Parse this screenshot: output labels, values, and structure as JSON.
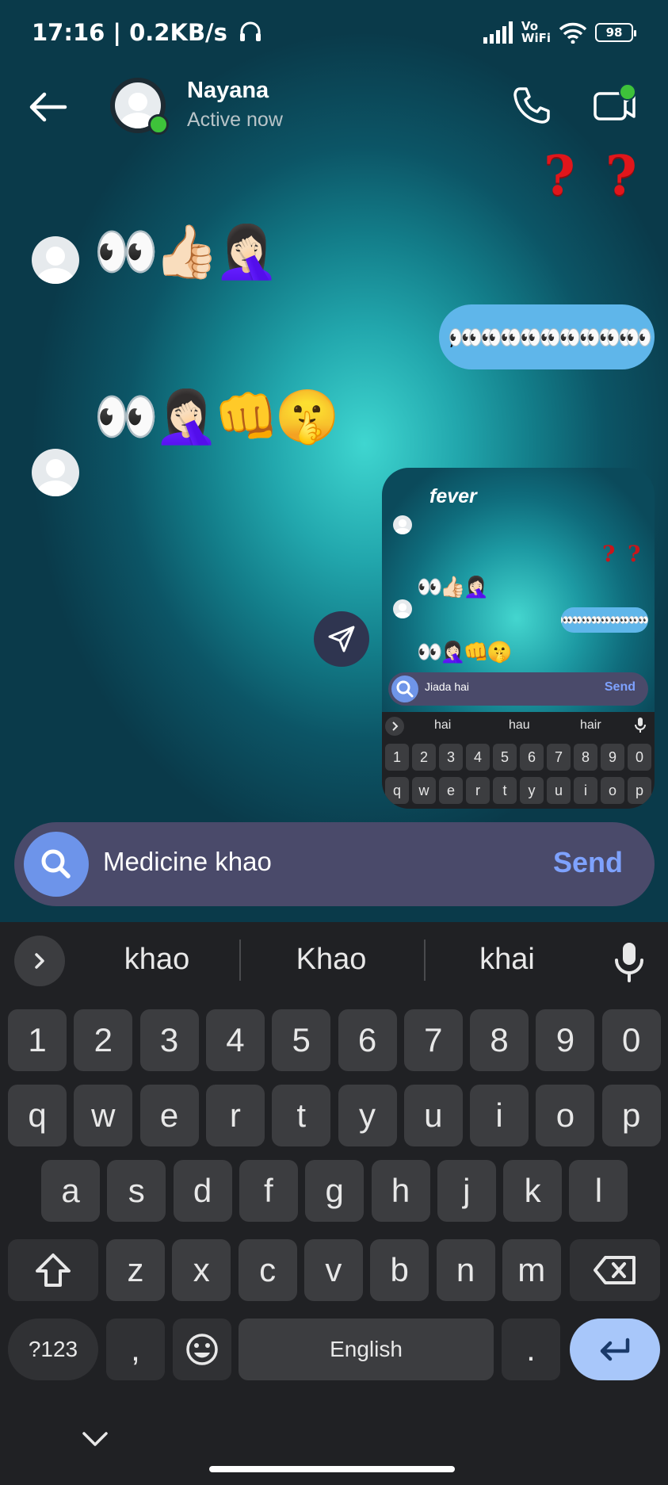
{
  "status_bar": {
    "time": "17:16 | 0.2KB/s",
    "vowifi_top": "Vo",
    "vowifi_bottom": "WiFi",
    "battery": "98"
  },
  "header": {
    "contact_name": "Nayana",
    "contact_status": "Active now"
  },
  "messages": {
    "question_marks": [
      "?",
      "?"
    ],
    "incoming_1": "👀👍🏻🤦🏻‍♀️",
    "outgoing_1": ",👀👀👀👀👀👀👀👀👀👀",
    "incoming_2": "👀🤦🏻‍♀️👊🤫"
  },
  "shared_screenshot": {
    "brand": "fever",
    "question_marks": [
      "?",
      "?"
    ],
    "incoming_1": "👀👍🏻🤦🏻‍♀️",
    "outgoing_1": "👀👀👀👀👀👀👀👀👀👀",
    "incoming_2": "👀🤦🏻‍♀️👊🤫",
    "input_text": "Jiada hai",
    "send_label": "Send",
    "suggestions": [
      "hai",
      "hau",
      "hair"
    ],
    "number_keys": [
      "1",
      "2",
      "3",
      "4",
      "5",
      "6",
      "7",
      "8",
      "9",
      "0"
    ],
    "letter_keys": [
      "q",
      "w",
      "e",
      "r",
      "t",
      "y",
      "u",
      "i",
      "o",
      "p"
    ]
  },
  "composer": {
    "input_value": "Medicine khao",
    "send_label": "Send"
  },
  "keyboard": {
    "suggestions": [
      "khao",
      "Khao",
      "khai"
    ],
    "row_numbers": [
      "1",
      "2",
      "3",
      "4",
      "5",
      "6",
      "7",
      "8",
      "9",
      "0"
    ],
    "row_top": [
      "q",
      "w",
      "e",
      "r",
      "t",
      "y",
      "u",
      "i",
      "o",
      "p"
    ],
    "row_middle": [
      "a",
      "s",
      "d",
      "f",
      "g",
      "h",
      "j",
      "k",
      "l"
    ],
    "row_bottom": [
      "z",
      "x",
      "c",
      "v",
      "b",
      "n",
      "m"
    ],
    "symbols_label": "?123",
    "comma_label": ",",
    "space_label": "English",
    "period_label": "."
  },
  "colors": {
    "accent_blue": "#7ea2ff",
    "bubble_blue": "#5fb6ea",
    "online_green": "#3ec23a",
    "question_red": "#e0161b",
    "keyboard_bg": "#202124",
    "key_bg": "#3c3d40"
  },
  "icons": {
    "back": "arrow-left-icon",
    "call": "phone-icon",
    "video": "video-camera-icon",
    "share": "paper-plane-icon",
    "search": "search-icon",
    "mic": "microphone-icon",
    "shift": "shift-arrow-icon",
    "backspace": "backspace-icon",
    "emoji": "smiley-icon",
    "enter": "enter-arrow-icon",
    "expand": "chevron-right-icon",
    "hide_keyboard": "chevron-down-icon"
  }
}
